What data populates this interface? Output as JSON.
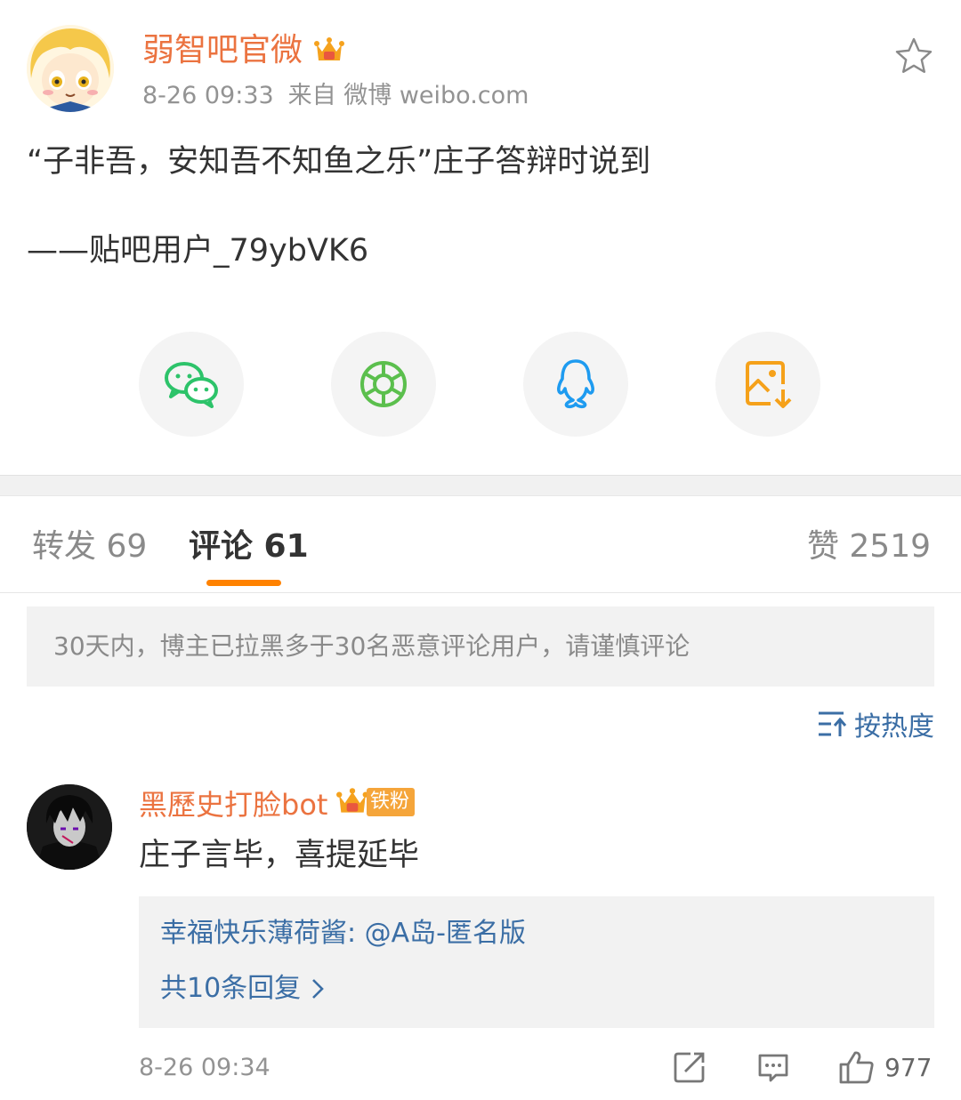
{
  "header": {
    "author_name": "弱智吧官微",
    "timestamp": "8-26 09:33",
    "source": "来自 微博 weibo.com",
    "verified_icon": "crown-vip-icon",
    "favorite_icon": "star-outline-icon"
  },
  "post": {
    "line1": "“子非吾，安知吾不知鱼之乐”庄子答辩时说到",
    "line2": "——贴吧用户_79ybVK6"
  },
  "share": [
    {
      "icon": "wechat-icon",
      "color": "#2dc36a"
    },
    {
      "icon": "moments-icon",
      "color": "#5bbf4d"
    },
    {
      "icon": "qq-icon",
      "color": "#1e9bf0"
    },
    {
      "icon": "save-image-icon",
      "color": "#f5a11a"
    }
  ],
  "tabs": {
    "repost": "转发 69",
    "comment": "评论 61",
    "like": "赞 2519",
    "active_color": "#ff8200"
  },
  "notice": "30天内，博主已拉黑多于30名恶意评论用户，请谨慎评论",
  "sort": {
    "label": "按热度",
    "icon": "sort-icon"
  },
  "comment": {
    "author": "黑歷史打脸bot",
    "badge": "铁粉",
    "text": "庄子言毕，喜提延毕",
    "reply_preview": "幸福快乐薄荷酱: @A岛-匿名版",
    "reply_more": "共10条回复",
    "time": "8-26 09:34",
    "likes": "977",
    "actions": [
      "repost-icon",
      "comment-icon",
      "thumbs-up-icon"
    ]
  },
  "colors": {
    "name_orange": "#eb7340",
    "link_blue": "#3b6ea5",
    "meta_gray": "#939393"
  }
}
